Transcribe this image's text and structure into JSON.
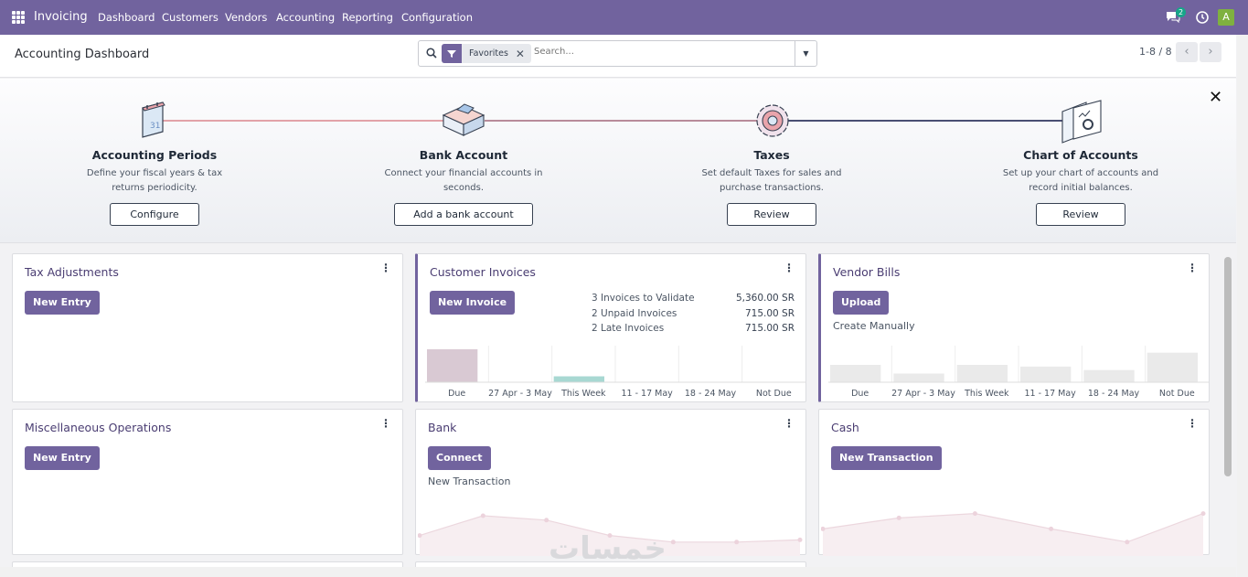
{
  "nav": {
    "app_name": "Invoicing",
    "menus": [
      "Dashboard",
      "Customers",
      "Vendors",
      "Accounting",
      "Reporting",
      "Configuration"
    ],
    "chat_count": "2",
    "avatar_letter": "A"
  },
  "control": {
    "page_title": "Accounting Dashboard",
    "facet": "Favorites",
    "search_placeholder": "Search...",
    "pager": "1-8 / 8"
  },
  "onboarding": {
    "steps": [
      {
        "title": "Accounting Periods",
        "desc": "Define your fiscal years & tax returns periodicity.",
        "button": "Configure"
      },
      {
        "title": "Bank Account",
        "desc": "Connect your financial accounts in seconds.",
        "button": "Add a bank account"
      },
      {
        "title": "Taxes",
        "desc": "Set default Taxes for sales and purchase transactions.",
        "button": "Review"
      },
      {
        "title": "Chart of Accounts",
        "desc": "Set up your chart of accounts and record initial balances.",
        "button": "Review"
      }
    ],
    "colors": {
      "done_line": "#e2a3a8",
      "todo_line": "#4a4f73"
    }
  },
  "cards": {
    "tax": {
      "title": "Tax Adjustments",
      "button": "New Entry"
    },
    "customer": {
      "title": "Customer Invoices",
      "button": "New Invoice",
      "stats": [
        {
          "label": "3 Invoices to Validate",
          "value": "5,360.00 SR"
        },
        {
          "label": "2 Unpaid Invoices",
          "value": "715.00 SR"
        },
        {
          "label": "2 Late Invoices",
          "value": "715.00 SR"
        }
      ],
      "bars": [
        {
          "label": "Due",
          "value": 0.95,
          "color": "#d9c9d3"
        },
        {
          "label": "27 Apr - 3 May",
          "value": 0,
          "color": "#a8d8d2"
        },
        {
          "label": "This Week",
          "value": 0.17,
          "color": "#a8d8d2"
        },
        {
          "label": "11 - 17 May",
          "value": 0,
          "color": "#a8d8d2"
        },
        {
          "label": "18 - 24 May",
          "value": 0,
          "color": "#a8d8d2"
        },
        {
          "label": "Not Due",
          "value": 0,
          "color": "#a8d8d2"
        }
      ]
    },
    "vendor": {
      "title": "Vendor Bills",
      "button": "Upload",
      "link": "Create Manually",
      "bars": [
        {
          "label": "Due",
          "value": 0.5,
          "color": "#eaeaea"
        },
        {
          "label": "27 Apr - 3 May",
          "value": 0.25,
          "color": "#eaeaea"
        },
        {
          "label": "This Week",
          "value": 0.5,
          "color": "#eaeaea"
        },
        {
          "label": "11 - 17 May",
          "value": 0.45,
          "color": "#eaeaea"
        },
        {
          "label": "18 - 24 May",
          "value": 0.35,
          "color": "#eaeaea"
        },
        {
          "label": "Not Due",
          "value": 0.85,
          "color": "#eaeaea"
        }
      ]
    },
    "misc": {
      "title": "Miscellaneous Operations",
      "button": "New Entry"
    },
    "bank": {
      "title": "Bank",
      "button": "Connect",
      "link": "New Transaction",
      "line": [
        0.3,
        0.75,
        0.65,
        0.3,
        0.15,
        0.15,
        0.2
      ]
    },
    "cash": {
      "title": "Cash",
      "button": "New Transaction",
      "line": [
        0.45,
        0.7,
        0.8,
        0.45,
        0.15,
        0.8
      ]
    }
  },
  "watermark": "خمسات"
}
